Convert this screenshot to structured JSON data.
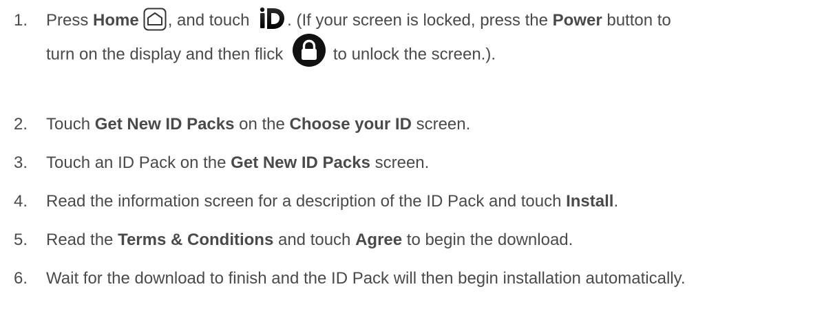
{
  "steps": [
    {
      "num": "1.",
      "line1": {
        "t1": "Press ",
        "b1": "Home",
        "t2": ", and touch ",
        "t3": ". (If your screen is locked, press the ",
        "b2": "Power",
        "t4": " button to"
      },
      "line2": {
        "t1": "turn on the display and then flick ",
        "t2": "to unlock the screen.)."
      },
      "icons": [
        "home-icon",
        "id-app-icon",
        "lock-icon"
      ]
    },
    {
      "num": "2.",
      "t1": "Touch ",
      "b1": "Get New ID Packs",
      "t2": " on the ",
      "b2": "Choose your ID",
      "t3": " screen."
    },
    {
      "num": "3.",
      "t1": "Touch an ID Pack on the ",
      "b1": "Get New ID Packs",
      "t2": " screen."
    },
    {
      "num": "4.",
      "t1": "Read the information screen for a description of the ID Pack and touch ",
      "b1": "Install",
      "t2": "."
    },
    {
      "num": "5.",
      "t1": "Read the ",
      "b1": "Terms & Conditions",
      "t2": " and touch ",
      "b2": "Agree",
      "t3": " to begin the download."
    },
    {
      "num": "6.",
      "t1": "Wait for the download to finish and the ID Pack will then begin installation automatically."
    }
  ],
  "colors": {
    "text": "#4a4a4a",
    "icon_dark": "#111111"
  }
}
